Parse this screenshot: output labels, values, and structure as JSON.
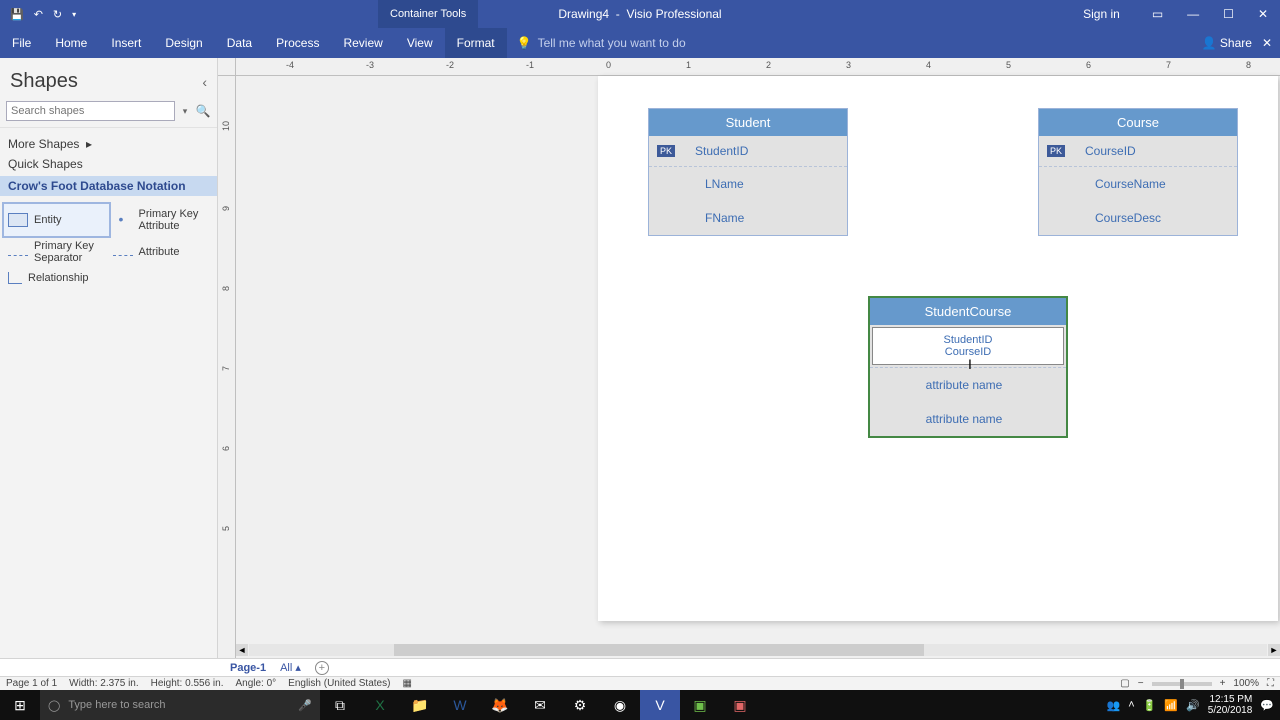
{
  "titlebar": {
    "context_tab": "Container Tools",
    "doc": "Drawing4",
    "app": "Visio Professional",
    "signin": "Sign in"
  },
  "ribbon": {
    "tabs": [
      "File",
      "Home",
      "Insert",
      "Design",
      "Data",
      "Process",
      "Review",
      "View",
      "Format"
    ],
    "active": "Format",
    "tellme": "Tell me what you want to do",
    "share": "Share"
  },
  "shapes": {
    "title": "Shapes",
    "search_placeholder": "Search shapes",
    "more": "More Shapes",
    "quick": "Quick Shapes",
    "stencil": "Crow's Foot Database Notation",
    "items": [
      "Entity",
      "Primary Key Attribute",
      "Primary Key Separator",
      "Attribute",
      "Relationship"
    ]
  },
  "ruler": {
    "h": [
      "-4",
      "-3",
      "-2",
      "-1",
      "0",
      "1",
      "2",
      "3",
      "4",
      "5",
      "6",
      "7",
      "8"
    ],
    "v": [
      "10",
      "9",
      "8",
      "7",
      "6",
      "5"
    ]
  },
  "entities": {
    "student": {
      "title": "Student",
      "pk": "PK",
      "pkfield": "StudentID",
      "a1": "LName",
      "a2": "FName"
    },
    "course": {
      "title": "Course",
      "pk": "PK",
      "pkfield": "CourseID",
      "a1": "CourseName",
      "a2": "CourseDesc"
    },
    "sc": {
      "title": "StudentCourse",
      "line1": "StudentID",
      "line2": "CourseID",
      "a1": "attribute name",
      "a2": "attribute name"
    }
  },
  "pagetabs": {
    "page": "Page-1",
    "all": "All"
  },
  "status": {
    "page": "Page 1 of 1",
    "width": "Width: 2.375 in.",
    "height": "Height: 0.556 in.",
    "angle": "Angle: 0°",
    "lang": "English (United States)",
    "zoom": "100%"
  },
  "taskbar": {
    "search": "Type here to search",
    "time": "12:15 PM",
    "date": "5/20/2018"
  }
}
